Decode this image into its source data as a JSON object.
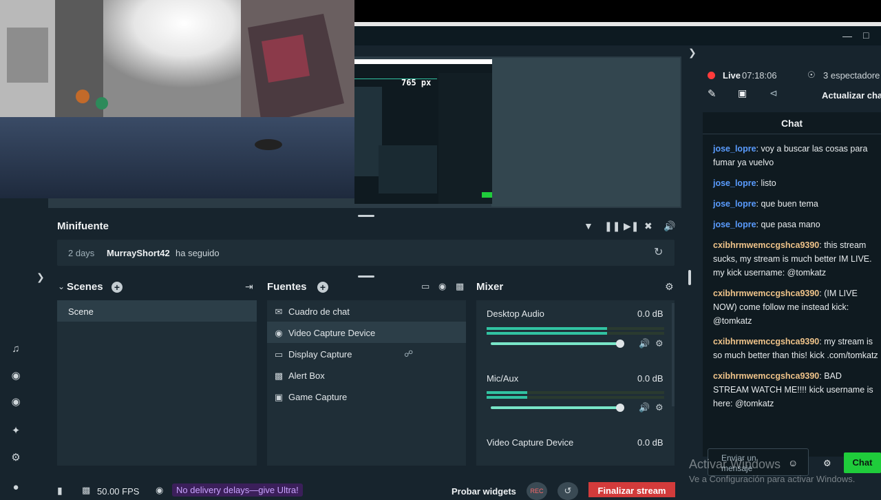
{
  "window": {
    "minimize_icon": "minimize-icon",
    "maximize_icon": "maximize-icon"
  },
  "nested_preview": {
    "px_label": "765 px"
  },
  "minifuente": {
    "title": "Minifuente",
    "alert": {
      "age": "2 days",
      "user": "MurrayShort42",
      "action": "ha seguido"
    }
  },
  "scenes": {
    "title": "Scenes",
    "items": [
      {
        "label": "Scene"
      }
    ]
  },
  "sources": {
    "title": "Fuentes",
    "items": [
      {
        "label": "Cuadro de chat",
        "icon": "chat-icon"
      },
      {
        "label": "Video Capture Device",
        "icon": "webcam-icon",
        "selected": true
      },
      {
        "label": "Display Capture",
        "icon": "monitor-icon",
        "locked": true
      },
      {
        "label": "Alert Box",
        "icon": "alert-box-icon"
      },
      {
        "label": "Game Capture",
        "icon": "gamepad-icon"
      }
    ]
  },
  "mixer": {
    "title": "Mixer",
    "channels": [
      {
        "name": "Desktop Audio",
        "db": "0.0 dB",
        "level": 0.68,
        "volume": 1.0
      },
      {
        "name": "Mic/Aux",
        "db": "0.0 dB",
        "level": 0.23,
        "volume": 1.0
      },
      {
        "name": "Video Capture Device",
        "db": "0.0 dB"
      }
    ]
  },
  "footer": {
    "fps": "50.00 FPS",
    "ultra_promo": "No delivery delays—give Ultra!",
    "test_widgets": "Probar widgets",
    "rec": "REC",
    "end_stream": "Finalizar stream"
  },
  "stream": {
    "live_label": "Live",
    "live_time": "07:18:06",
    "viewers": "3 espectadore",
    "update_chat": "Actualizar cha"
  },
  "chat": {
    "title": "Chat",
    "messages": [
      {
        "user": "jose_lopre",
        "text": ": voy a buscar las cosas para fumar ya vuelvo",
        "color": "#5a9cff"
      },
      {
        "user": "jose_lopre",
        "text": ": listo",
        "color": "#5a9cff"
      },
      {
        "user": "jose_lopre",
        "text": ": que buen tema",
        "color": "#5a9cff"
      },
      {
        "user": "jose_lopre",
        "text": ": que pasa mano",
        "color": "#5a9cff"
      },
      {
        "user": "cxibhrmwemccgshca9390",
        "text": ": this stream sucks, my stream is much better IM LIVE. my kick username: @tomkatz",
        "color": "#f0c48a"
      },
      {
        "user": "cxibhrmwemccgshca9390",
        "text": ": (IM LIVE NOW) come follow me instead kick: @tomkatz",
        "color": "#f0c48a"
      },
      {
        "user": "cxibhrmwemccgshca9390",
        "text": ": my stream is so much better than this! kick .com/tomkatz",
        "color": "#f0c48a"
      },
      {
        "user": "cxibhrmwemccgshca9390",
        "text": ": BAD STREAM WATCH ME!!!! kick username is here: @tomkatz",
        "color": "#f0c48a"
      }
    ],
    "input_placeholder": "Enviar un mensaje",
    "send_label": "Chat"
  },
  "watermark": {
    "line1": "Activar Windows",
    "line2": "Ve a Configuración para activar Windows."
  },
  "colors": {
    "accent_green": "#31c3a2",
    "live_red": "#ff3b3b",
    "chat_send_green": "#1fcc3b",
    "end_stream_red": "#d33b3b"
  }
}
